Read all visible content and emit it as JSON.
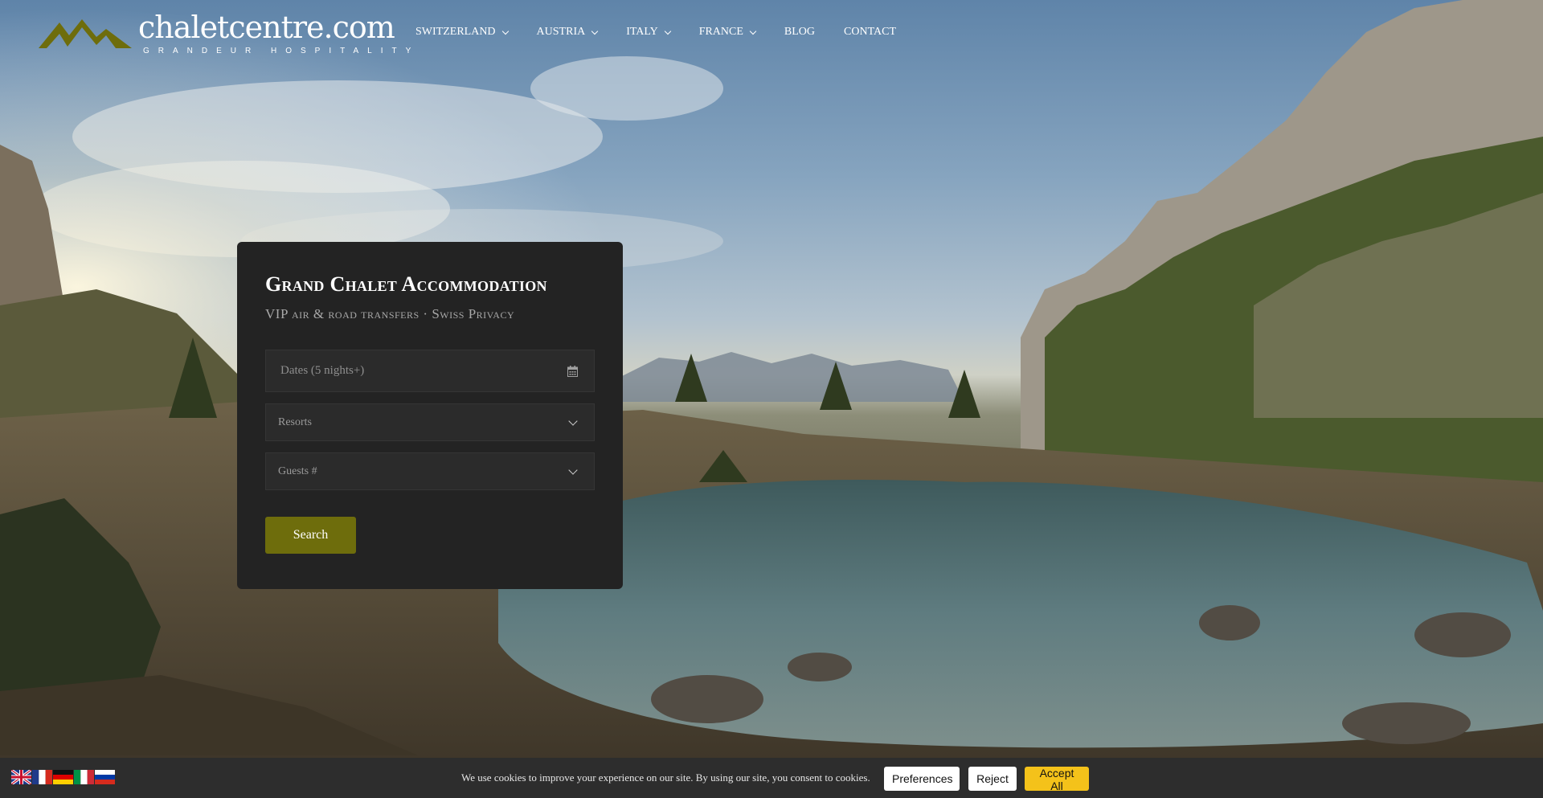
{
  "brand": {
    "name": "chaletcentre.com",
    "tagline": "GRANDEUR HOSPITALITY",
    "accent_color": "#6e6d0c"
  },
  "nav": {
    "items": [
      {
        "label": "SWITZERLAND",
        "dropdown": true
      },
      {
        "label": "AUSTRIA",
        "dropdown": true
      },
      {
        "label": "ITALY",
        "dropdown": true
      },
      {
        "label": "FRANCE",
        "dropdown": true
      },
      {
        "label": "BLOG",
        "dropdown": false
      },
      {
        "label": "CONTACT",
        "dropdown": false
      }
    ]
  },
  "booking": {
    "title": "Grand Chalet Accommodation",
    "subtitle": "VIP air & road transfers · Swiss Privacy",
    "dates_placeholder": "Dates (5 nights+)",
    "dates_icon": "calendar-icon",
    "resorts_label": "Resorts",
    "guests_label": "Guests #",
    "search_label": "Search"
  },
  "languages": [
    {
      "code": "en",
      "icon": "flag-uk-icon"
    },
    {
      "code": "fr",
      "icon": "flag-france-icon"
    },
    {
      "code": "de",
      "icon": "flag-germany-icon"
    },
    {
      "code": "it",
      "icon": "flag-italy-icon"
    },
    {
      "code": "ru",
      "icon": "flag-russia-icon"
    }
  ],
  "cookies": {
    "message": "We use cookies to improve your experience on our site. By using our site, you consent to cookies.",
    "preferences_label": "Preferences",
    "reject_label": "Reject",
    "accept_label": "Accept All",
    "accept_color": "#f4c21a"
  }
}
